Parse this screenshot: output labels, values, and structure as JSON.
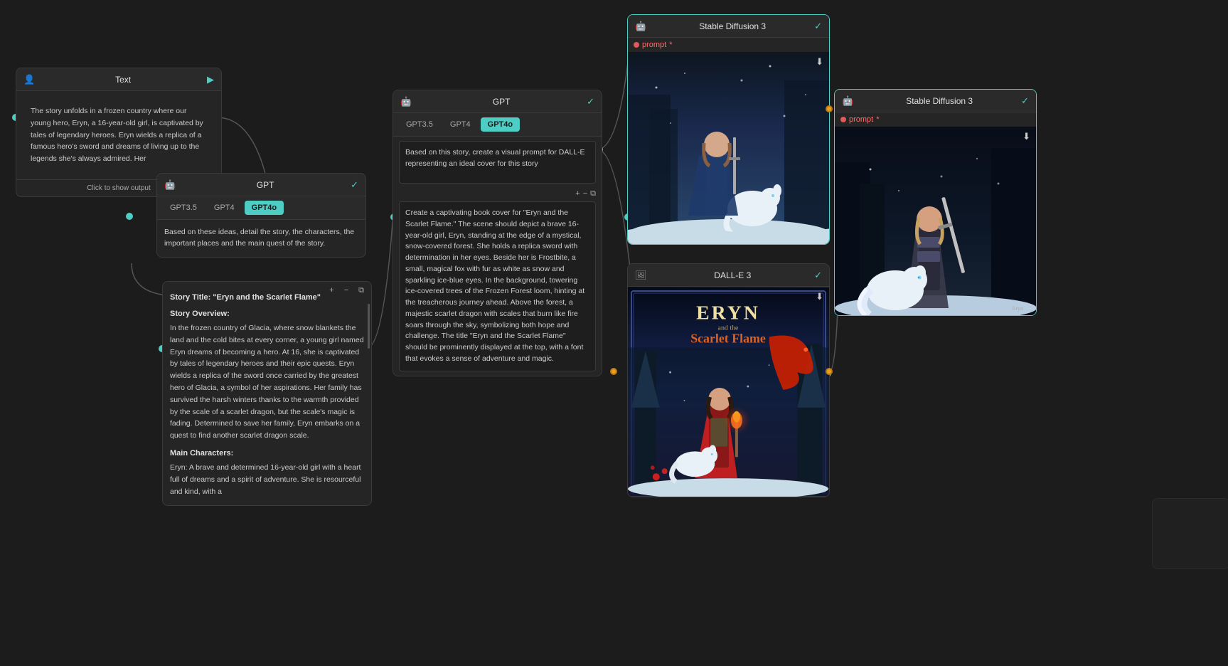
{
  "nodes": {
    "text_node": {
      "title": "Text",
      "content": "The story unfolds in a frozen country where our young hero, Eryn, a 16-year-old girl, is captivated by tales of legendary heroes. Eryn wields a replica of a famous hero's sword and dreams of living up to the legends she's always admired. Her",
      "show_output": "Click to show output"
    },
    "gpt_node_left": {
      "title": "GPT",
      "tabs": [
        "GPT3.5",
        "GPT4",
        "GPT4o"
      ],
      "active_tab": "GPT4o",
      "prompt": "Based on these ideas, detail the story, the characters, the important places and the main quest of the story."
    },
    "story_node": {
      "title_text": "Story Title: \"Eryn and the Scarlet Flame\"",
      "overview_label": "Story Overview:",
      "overview_text": "In the frozen country of Glacia, where snow blankets the land and the cold bites at every corner, a young girl named Eryn dreams of becoming a hero. At 16, she is captivated by tales of legendary heroes and their epic quests. Eryn wields a replica of the sword once carried by the greatest hero of Glacia, a symbol of her aspirations. Her family has survived the harsh winters thanks to the warmth provided by the scale of a scarlet dragon, but the scale's magic is fading. Determined to save her family, Eryn embarks on a quest to find another scarlet dragon scale.",
      "characters_label": "Main Characters:",
      "character1": "Eryn: A brave and determined 16-year-old girl with a heart full of dreams and a spirit of adventure. She is resourceful and kind, with a"
    },
    "gpt_node_center": {
      "title": "GPT",
      "tabs": [
        "GPT3.5",
        "GPT4",
        "GPT4o"
      ],
      "active_tab": "GPT4o",
      "prompt": "Based on this story, create a visual prompt for DALL-E representing an ideal cover for this story",
      "output_label": "Create a captivating book cover for \"Eryn and the Scarlet Flame.\" The scene should depict a brave 16-year-old girl, Eryn, standing at the edge of a mystical, snow-covered forest. She holds a replica sword with determination in her eyes. Beside her is Frostbite, a small, magical fox with fur as white as snow and sparkling ice-blue eyes. In the background, towering ice-covered trees of the Frozen Forest loom, hinting at the treacherous journey ahead. Above the forest, a majestic scarlet dragon with scales that burn like fire soars through the sky, symbolizing both hope and challenge. The title \"Eryn and the Scarlet Flame\" should be prominently displayed at the top, with a font that evokes a sense of adventure and magic."
    },
    "stable_diffusion_top": {
      "title": "Stable Diffusion 3",
      "prompt_label": "prompt",
      "download_icon": "↓"
    },
    "stable_diffusion_right": {
      "title": "Stable Diffusion 3",
      "prompt_label": "prompt",
      "download_icon": "↓"
    },
    "dalle_node": {
      "title": "DALL-E 3",
      "download_icon": "↓"
    }
  },
  "colors": {
    "background": "#1c1c1c",
    "node_bg": "#252525",
    "node_header": "#2a2a2a",
    "teal_accent": "#4ecdc4",
    "border": "#3a3a3a",
    "text_primary": "#e0e0e0",
    "text_secondary": "#ccc",
    "text_muted": "#aaa",
    "red_dot": "#e05a5a",
    "orange_dot": "#e8a020",
    "error_red": "#ff6b6b"
  },
  "icons": {
    "robot": "🤖",
    "image": "🖼",
    "check": "✓",
    "play": "▶",
    "download": "⬇",
    "plus": "+",
    "minus": "−",
    "copy": "⧉"
  }
}
